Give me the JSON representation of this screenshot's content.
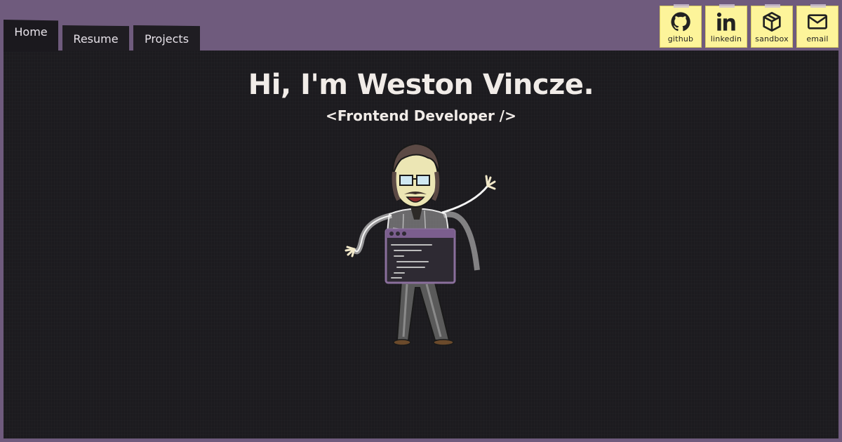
{
  "tabs": [
    {
      "label": "Home",
      "active": true
    },
    {
      "label": "Resume",
      "active": false
    },
    {
      "label": "Projects",
      "active": false
    }
  ],
  "social": [
    {
      "label": "github",
      "icon": "github-icon"
    },
    {
      "label": "linkedin",
      "icon": "linkedin-icon"
    },
    {
      "label": "sandbox",
      "icon": "cube-icon"
    },
    {
      "label": "email",
      "icon": "envelope-icon"
    }
  ],
  "hero": {
    "title": "Hi, I'm Weston Vincze.",
    "subtitle": "<Frontend Developer />"
  },
  "colors": {
    "background": "#6f5b7d",
    "panel": "#1c1b1f",
    "tab": "#1f1d22",
    "social_button": "#fdf49a",
    "text": "#f1ece8"
  }
}
